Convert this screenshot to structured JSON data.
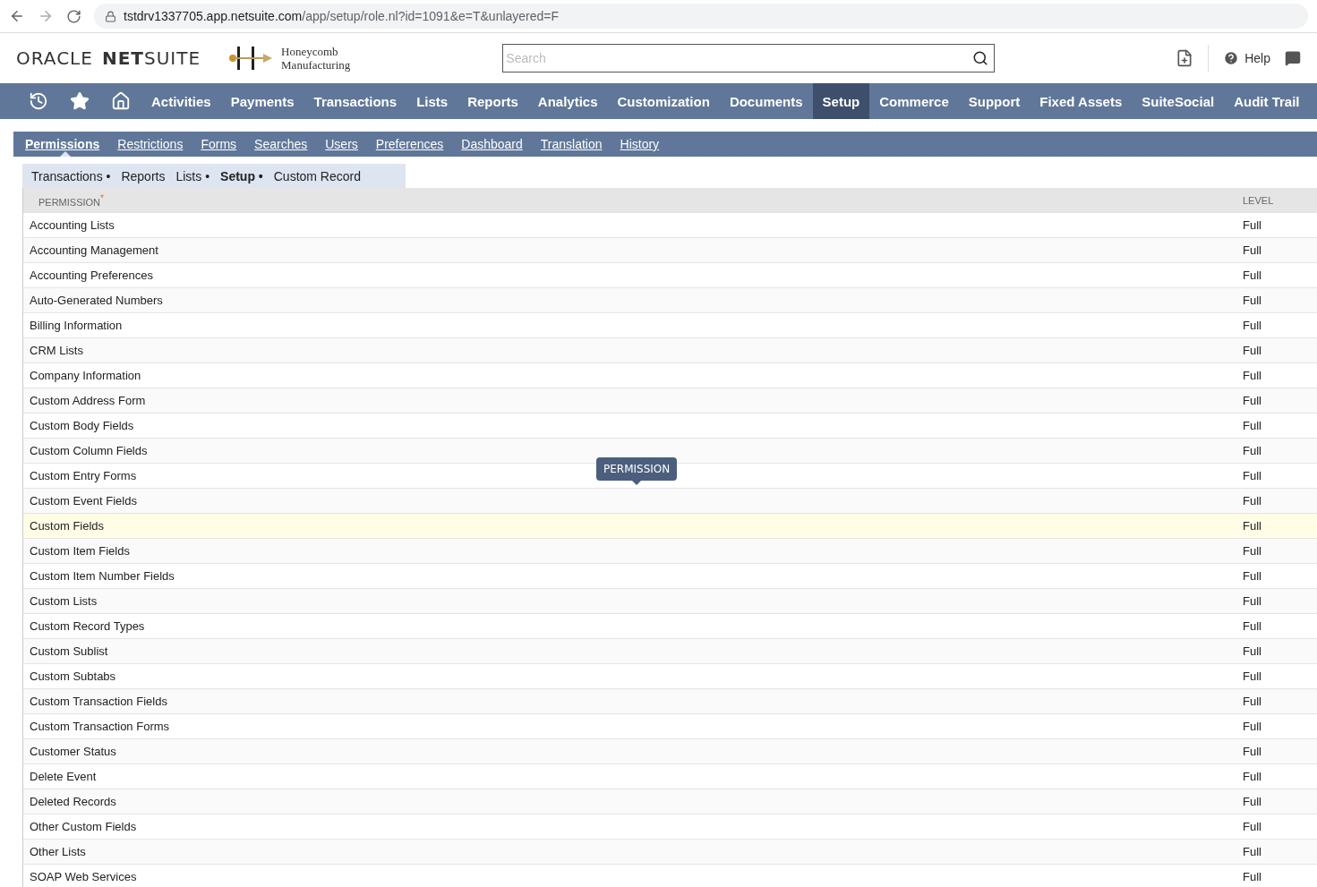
{
  "browser": {
    "url_host": "tstdrv1337705.app.netsuite.com",
    "url_path": "/app/setup/role.nl?id=1091&e=T&unlayered=F"
  },
  "header": {
    "logo": {
      "brand": "ORACLE",
      "product_bold": "NET",
      "product": "SUITE"
    },
    "company": [
      "Honeycomb",
      "Manufacturing"
    ],
    "search": {
      "placeholder": "Search"
    },
    "help": "Help"
  },
  "nav": [
    {
      "label": "Activities",
      "selected": false
    },
    {
      "label": "Payments",
      "selected": false
    },
    {
      "label": "Transactions",
      "selected": false
    },
    {
      "label": "Lists",
      "selected": false
    },
    {
      "label": "Reports",
      "selected": false
    },
    {
      "label": "Analytics",
      "selected": false
    },
    {
      "label": "Customization",
      "selected": false
    },
    {
      "label": "Documents",
      "selected": false
    },
    {
      "label": "Setup",
      "selected": true
    },
    {
      "label": "Commerce",
      "selected": false
    },
    {
      "label": "Support",
      "selected": false
    },
    {
      "label": "Fixed Assets",
      "selected": false
    },
    {
      "label": "SuiteSocial",
      "selected": false
    },
    {
      "label": "Audit Trail",
      "selected": false
    }
  ],
  "tabs": [
    {
      "label": "Permissions",
      "selected": true
    },
    {
      "label": "Restrictions",
      "selected": false
    },
    {
      "label": "Forms",
      "selected": false
    },
    {
      "label": "Searches",
      "selected": false
    },
    {
      "label": "Users",
      "selected": false
    },
    {
      "label": "Preferences",
      "selected": false
    },
    {
      "label": "Dashboard",
      "selected": false
    },
    {
      "label": "Translation",
      "selected": false
    },
    {
      "label": "History",
      "selected": false
    }
  ],
  "subtabs": [
    {
      "label": "Transactions",
      "selected": false,
      "marker": "•"
    },
    {
      "label": "Reports",
      "selected": false
    },
    {
      "label": "Lists",
      "selected": false,
      "marker": "•"
    },
    {
      "label": "Setup",
      "selected": true,
      "marker": "•"
    },
    {
      "label": "Custom Record",
      "selected": false
    }
  ],
  "table": {
    "columns": [
      {
        "label": "PERMISSION",
        "required_mark": "*"
      },
      {
        "label": "LEVEL"
      }
    ],
    "rows": [
      {
        "permission": "Accounting Lists",
        "level": "Full",
        "highlighted": false
      },
      {
        "permission": "Accounting Management",
        "level": "Full",
        "highlighted": false
      },
      {
        "permission": "Accounting Preferences",
        "level": "Full",
        "highlighted": false
      },
      {
        "permission": "Auto-Generated Numbers",
        "level": "Full",
        "highlighted": false
      },
      {
        "permission": "Billing Information",
        "level": "Full",
        "highlighted": false
      },
      {
        "permission": "CRM Lists",
        "level": "Full",
        "highlighted": false
      },
      {
        "permission": "Company Information",
        "level": "Full",
        "highlighted": false
      },
      {
        "permission": "Custom Address Form",
        "level": "Full",
        "highlighted": false
      },
      {
        "permission": "Custom Body Fields",
        "level": "Full",
        "highlighted": false
      },
      {
        "permission": "Custom Column Fields",
        "level": "Full",
        "highlighted": false
      },
      {
        "permission": "Custom Entry Forms",
        "level": "Full",
        "highlighted": false
      },
      {
        "permission": "Custom Event Fields",
        "level": "Full",
        "highlighted": false
      },
      {
        "permission": "Custom Fields",
        "level": "Full",
        "highlighted": true
      },
      {
        "permission": "Custom Item Fields",
        "level": "Full",
        "highlighted": false
      },
      {
        "permission": "Custom Item Number Fields",
        "level": "Full",
        "highlighted": false
      },
      {
        "permission": "Custom Lists",
        "level": "Full",
        "highlighted": false
      },
      {
        "permission": "Custom Record Types",
        "level": "Full",
        "highlighted": false
      },
      {
        "permission": "Custom Sublist",
        "level": "Full",
        "highlighted": false
      },
      {
        "permission": "Custom Subtabs",
        "level": "Full",
        "highlighted": false
      },
      {
        "permission": "Custom Transaction Fields",
        "level": "Full",
        "highlighted": false
      },
      {
        "permission": "Custom Transaction Forms",
        "level": "Full",
        "highlighted": false
      },
      {
        "permission": "Customer Status",
        "level": "Full",
        "highlighted": false
      },
      {
        "permission": "Delete Event",
        "level": "Full",
        "highlighted": false
      },
      {
        "permission": "Deleted Records",
        "level": "Full",
        "highlighted": false
      },
      {
        "permission": "Other Custom Fields",
        "level": "Full",
        "highlighted": false
      },
      {
        "permission": "Other Lists",
        "level": "Full",
        "highlighted": false
      },
      {
        "permission": "SOAP Web Services",
        "level": "Full",
        "highlighted": false
      }
    ]
  },
  "tooltip": "PERMISSION"
}
